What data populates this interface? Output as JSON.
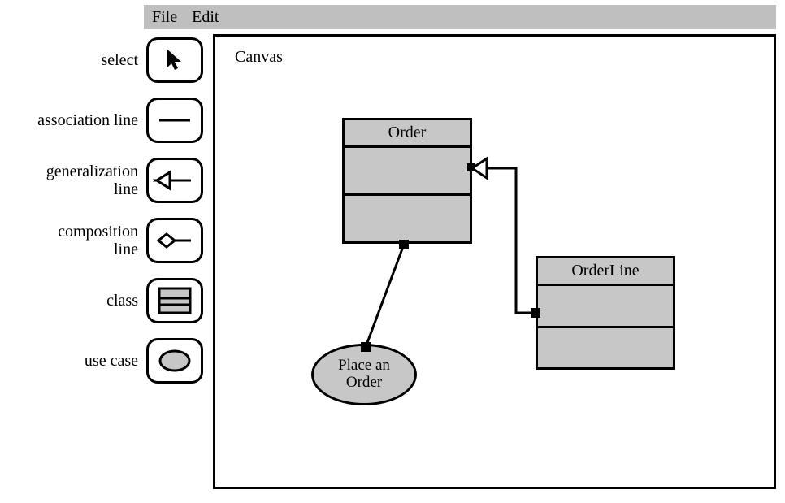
{
  "menu": {
    "file": "File",
    "edit": "Edit"
  },
  "tools": {
    "select": "select",
    "association": "association line",
    "generalization": "generalization line",
    "composition": "composition line",
    "class": "class",
    "usecase": "use case"
  },
  "canvas": {
    "title": "Canvas",
    "classOrder": {
      "name": "Order"
    },
    "classOrderLine": {
      "name": "OrderLine"
    },
    "usecasePlaceOrder": {
      "name": "Place an Order"
    }
  }
}
